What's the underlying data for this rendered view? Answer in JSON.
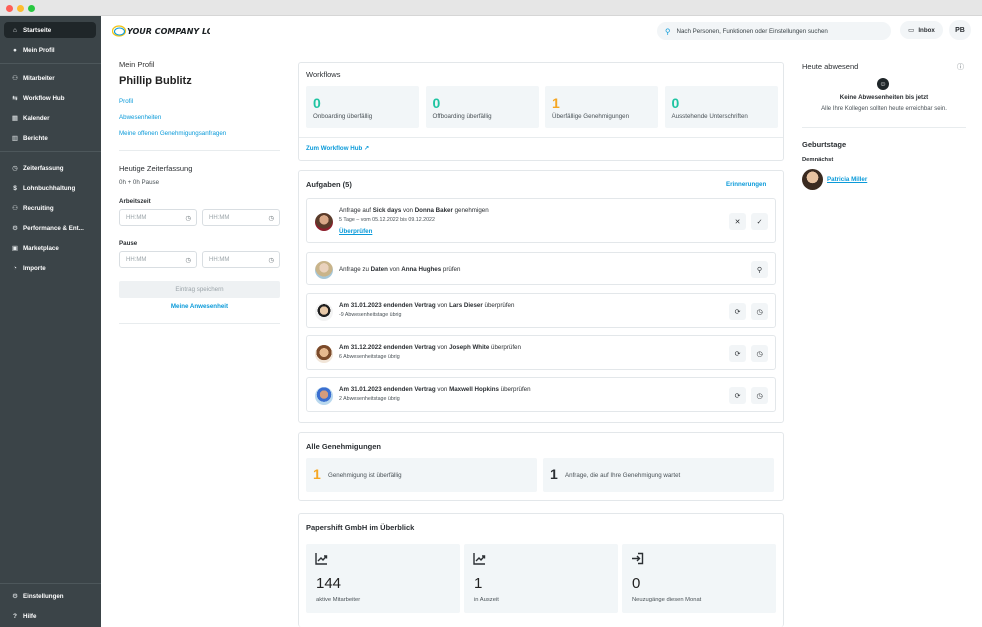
{
  "logo": {
    "text": "YOUR COMPANY LOGO"
  },
  "sidebar": {
    "top_items": [
      {
        "label": "Startseite",
        "icon": "home-icon",
        "glyph": "⌂",
        "active": true
      },
      {
        "label": "Mein Profil",
        "icon": "user-icon",
        "glyph": "●",
        "active": false
      }
    ],
    "mid_items": [
      {
        "label": "Mitarbeiter",
        "icon": "users-icon",
        "glyph": "⚇"
      },
      {
        "label": "Workflow Hub",
        "icon": "workflow-icon",
        "glyph": "⇆"
      },
      {
        "label": "Kalender",
        "icon": "calendar-icon",
        "glyph": "▦"
      },
      {
        "label": "Berichte",
        "icon": "chart-icon",
        "glyph": "▥"
      }
    ],
    "modules": [
      {
        "label": "Zeiterfassung",
        "icon": "clock-icon",
        "glyph": "◷"
      },
      {
        "label": "Lohnbuchhaltung",
        "icon": "dollar-icon",
        "glyph": "$"
      },
      {
        "label": "Recruiting",
        "icon": "recruiting-icon",
        "glyph": "⚇"
      },
      {
        "label": "Performance & Ent...",
        "icon": "performance-icon",
        "glyph": "⚙"
      },
      {
        "label": "Marketplace",
        "icon": "marketplace-icon",
        "glyph": "▣"
      },
      {
        "label": "Importe",
        "icon": "import-icon",
        "glyph": "◔"
      }
    ],
    "bottom_items": [
      {
        "label": "Einstellungen",
        "icon": "gear-icon",
        "glyph": "⚙"
      },
      {
        "label": "Hilfe",
        "icon": "help-icon",
        "glyph": "?"
      }
    ]
  },
  "header": {
    "search_placeholder": "Nach Personen, Funktionen oder Einstellungen suchen",
    "inbox_label": "Inbox",
    "user_initials": "PB"
  },
  "profile": {
    "section_title": "Mein Profil",
    "name": "Phillip Bublitz",
    "links": [
      "Profil",
      "Abwesenheiten",
      "Meine offenen Genehmigungsanfragen"
    ]
  },
  "time_tracking": {
    "title": "Heutige Zeiterfassung",
    "summary": "0h + 0h Pause",
    "work_label": "Arbeitszeit",
    "break_label": "Pause",
    "placeholder": "HH:MM",
    "save_label": "Eintrag speichern",
    "attendance_link": "Meine Anwesenheit"
  },
  "workflows": {
    "title": "Workflows",
    "stats": [
      {
        "value": "0",
        "label": "Onboarding überfällig",
        "color": "#1fc4a2"
      },
      {
        "value": "0",
        "label": "Offboarding überfällig",
        "color": "#1fc4a2"
      },
      {
        "value": "1",
        "label": "Überfällige Genehmigungen",
        "color": "#f5a623"
      },
      {
        "value": "0",
        "label": "Ausstehende Unterschriften",
        "color": "#1fc4a2"
      }
    ],
    "hub_link": "Zum Workflow Hub"
  },
  "tasks": {
    "title": "Aufgaben (5)",
    "reminders_link": "Erinnerungen",
    "items": [
      {
        "parts": [
          [
            "Anfrage auf ",
            false
          ],
          [
            "Sick days",
            true
          ],
          [
            " von ",
            false
          ],
          [
            "Donna Baker",
            true
          ],
          [
            " genehmigen",
            false
          ]
        ],
        "sub": "5 Tage – vom 05.12.2022 bis 09.12.2022",
        "action_link": "Überprüfen",
        "buttons": [
          {
            "glyph": "✕",
            "name": "reject-icon"
          },
          {
            "glyph": "✓",
            "name": "check-icon"
          }
        ]
      },
      {
        "parts": [
          [
            "Anfrage zu ",
            false
          ],
          [
            "Daten",
            true
          ],
          [
            " von ",
            false
          ],
          [
            "Anna Hughes",
            true
          ],
          [
            " prüfen",
            false
          ]
        ],
        "sub": "",
        "buttons": [
          {
            "glyph": "⚲",
            "name": "search-icon"
          }
        ]
      },
      {
        "parts": [
          [
            "Am 31.01.2023 endenden Vertrag",
            true
          ],
          [
            " von ",
            false
          ],
          [
            "Lars Dieser",
            true
          ],
          [
            " überprüfen",
            false
          ]
        ],
        "sub": "-9 Abwesenheitstage übrig",
        "buttons": [
          {
            "glyph": "⟳",
            "name": "renew-icon"
          },
          {
            "glyph": "◷",
            "name": "clock-icon"
          }
        ]
      },
      {
        "parts": [
          [
            "Am 31.12.2022 endenden Vertrag",
            true
          ],
          [
            " von ",
            false
          ],
          [
            "Joseph White",
            true
          ],
          [
            " überprüfen",
            false
          ]
        ],
        "sub": "6 Abwesenheitstage übrig",
        "buttons": [
          {
            "glyph": "⟳",
            "name": "renew-icon"
          },
          {
            "glyph": "◷",
            "name": "clock-icon"
          }
        ]
      },
      {
        "parts": [
          [
            "Am 31.01.2023 endenden Vertrag",
            true
          ],
          [
            " von ",
            false
          ],
          [
            "Maxwell Hopkins",
            true
          ],
          [
            " überprüfen",
            false
          ]
        ],
        "sub": "2 Abwesenheitstage übrig",
        "buttons": [
          {
            "glyph": "⟳",
            "name": "renew-icon"
          },
          {
            "glyph": "◷",
            "name": "clock-icon"
          }
        ]
      }
    ]
  },
  "approvals": {
    "title": "Alle Genehmigungen",
    "items": [
      {
        "value": "1",
        "label": "Genehmigung ist überfällig",
        "color": "#f5a623"
      },
      {
        "value": "1",
        "label": "Anfrage, die auf Ihre Genehmigung wartet",
        "color": "#2b2f33"
      }
    ]
  },
  "overview": {
    "title": "Papershift GmbH im Überblick",
    "items": [
      {
        "value": "144",
        "label": "aktive Mitarbeiter",
        "icon": "trend-up-icon"
      },
      {
        "value": "1",
        "label": "in Auszeit",
        "icon": "trend-up-icon"
      },
      {
        "value": "0",
        "label": "Neuzugänge diesen Monat",
        "icon": "login-icon"
      }
    ]
  },
  "absent": {
    "title": "Heute abwesend",
    "empty_title": "Keine Abwesenheiten bis jetzt",
    "empty_text": "Alle Ihre Kollegen sollten heute erreichbar sein."
  },
  "birthdays": {
    "title": "Geburtstage",
    "subtitle": "Demnächst",
    "person": "Patricia Miller"
  }
}
